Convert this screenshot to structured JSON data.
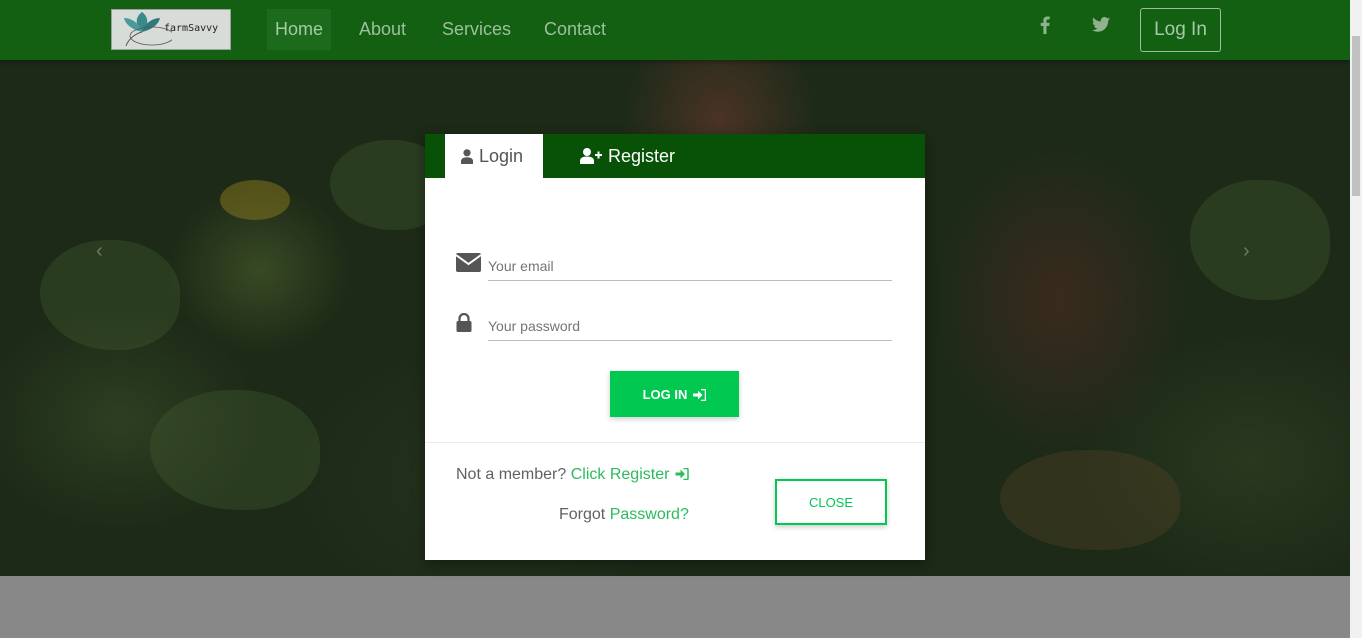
{
  "navbar": {
    "logo_text": "farmSavvy",
    "items": [
      {
        "label": "Home",
        "active": true
      },
      {
        "label": "About",
        "active": false
      },
      {
        "label": "Services",
        "active": false
      },
      {
        "label": "Contact",
        "active": false
      }
    ],
    "social_icons": [
      "facebook-icon",
      "twitter-icon"
    ],
    "login_label": "Log In"
  },
  "carousel": {
    "prev_icon": "‹",
    "next_icon": "›"
  },
  "modal": {
    "tabs": [
      {
        "label": "Login",
        "icon": "user-icon",
        "active": true
      },
      {
        "label": "Register",
        "icon": "user-plus-icon",
        "active": false
      }
    ],
    "email_placeholder": "Your email",
    "password_placeholder": "Your password",
    "submit_label": "LOG IN",
    "footer": {
      "member_prefix": "Not a member?",
      "member_link_click": "Click",
      "member_link_register": "Register",
      "forgot_prefix": "Forgot",
      "forgot_link": "Password?"
    },
    "close_label": "CLOSE"
  },
  "colors": {
    "navbar": "#136013",
    "modal_tabs": "#075207",
    "accent_green": "#00c851",
    "link_green": "#2bbb5b"
  }
}
